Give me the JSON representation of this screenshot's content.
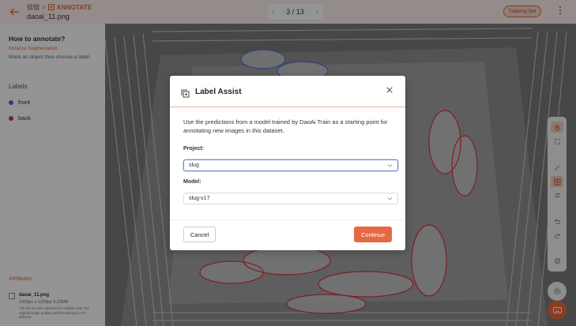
{
  "header": {
    "back_icon": "arrow-left-icon",
    "breadcrumb_project": "链锯",
    "breadcrumb_sep": ">",
    "breadcrumb_section": "ANNOTATE",
    "filename": "daoai_11.png",
    "pager_prev": "‹",
    "pager_text": "3 / 13",
    "pager_next": "›",
    "training_set_label": "Training Set",
    "menu_icon": "more-vertical-icon"
  },
  "sidebar": {
    "how_title": "How to annotate?",
    "annotation_type": "Instance Segmentation",
    "instructions": "Mask an object then choose a label.",
    "labels_heading": "Labels",
    "labels": [
      {
        "name": "front",
        "color": "#4f6fd6"
      },
      {
        "name": "back",
        "color": "#d9363e"
      }
    ],
    "attributes_heading": "Attributes",
    "file": {
      "name": "daoai_11.png",
      "meta": "1920px x 1200px 5.22MB",
      "note": "The file size are optimized for display only. The original image quality used for training is not affected."
    }
  },
  "toolbar": {
    "tools": [
      "hand-icon",
      "box-select-icon",
      "magic-wand-icon",
      "label-assist-icon",
      "swap-icon",
      "undo-icon",
      "redo-icon",
      "hide-icon"
    ],
    "active_tools": [
      "hand-icon",
      "label-assist-icon"
    ]
  },
  "modal": {
    "title": "Label Assist",
    "description": "Use the predictions from a model trained by DaoAi Train as a starting point for annotating new images in this dataset.",
    "project_label": "Project:",
    "project_value": "slug",
    "model_label": "Model:",
    "model_value": "slug-v17",
    "cancel_label": "Cancel",
    "continue_label": "Continue"
  },
  "colors": {
    "accent": "#e8693f",
    "label_front": "#4f6fd6",
    "label_back": "#d9363e"
  }
}
